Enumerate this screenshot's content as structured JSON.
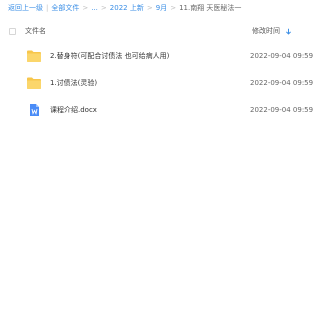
{
  "breadcrumb": {
    "back": "返回上一级",
    "root": "全部文件",
    "ellipsis": "...",
    "folder_year": "2022 上新",
    "folder_month": "9月",
    "current": "11.南翔 天医秘法一"
  },
  "header": {
    "name_label": "文件名",
    "time_label": "修改时间"
  },
  "files": [
    {
      "name": "2.替身符(可配合讨债法 也可给病人用)",
      "time": "2022-09-04 09:59",
      "icon": "folder-icon"
    },
    {
      "name": "1.讨债法(灵验)",
      "time": "2022-09-04 09:59",
      "icon": "folder-icon"
    },
    {
      "name": "课程介绍.docx",
      "time": "2022-09-04 09:59",
      "icon": "docx-icon"
    }
  ],
  "colors": {
    "link": "#3a8ee6",
    "folder": "#f7c64b",
    "docx": "#4a8cf7"
  }
}
